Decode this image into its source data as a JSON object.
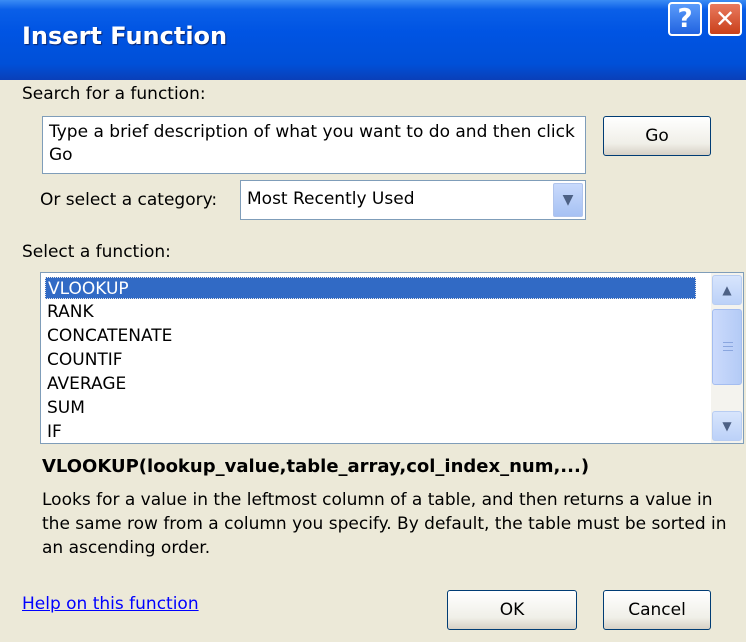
{
  "dialog": {
    "title": "Insert Function",
    "help_button": "?",
    "close_button": "✕"
  },
  "search": {
    "label": "Search for a function:",
    "value": "Type a brief description of what you want to do and then click Go",
    "go_label": "Go"
  },
  "category": {
    "label": "Or select a category:",
    "selected": "Most Recently Used"
  },
  "functions": {
    "label": "Select a function:",
    "items": [
      "VLOOKUP",
      "RANK",
      "CONCATENATE",
      "COUNTIF",
      "AVERAGE",
      "SUM",
      "IF"
    ],
    "selected_index": 0
  },
  "details": {
    "syntax": "VLOOKUP(lookup_value,table_array,col_index_num,...)",
    "description": "Looks for a value in the leftmost column of a table, and then returns a value in the same row from a column you specify. By default, the table must be sorted in an ascending order."
  },
  "footer": {
    "help_link": "Help on this function",
    "ok_label": "OK",
    "cancel_label": "Cancel"
  },
  "icons": {
    "dropdown": "▼",
    "scroll_up": "▲",
    "scroll_down": "▼"
  },
  "colors": {
    "titlebar": "#0054e3",
    "selection": "#316ac5",
    "dialog_bg": "#ece9d8",
    "link": "#0000ff"
  }
}
